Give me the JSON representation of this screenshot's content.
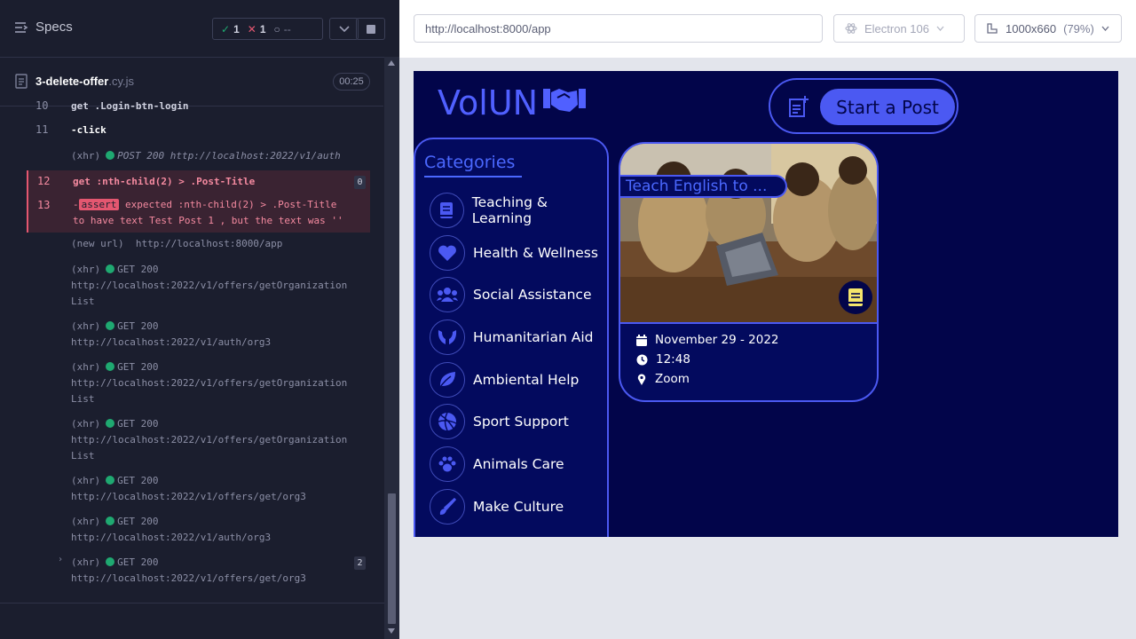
{
  "runner": {
    "specs_label": "Specs",
    "passed": "1",
    "failed": "1",
    "pending": "--",
    "file": {
      "name": "3-delete-offer",
      "ext": ".cy.js",
      "time": "00:25"
    }
  },
  "log": {
    "partial": {
      "num": "10",
      "text": "get  .Login-btn-login"
    },
    "click": {
      "num": "11",
      "text": "-click"
    },
    "xhr_auth": {
      "label": "(xhr)",
      "text": "POST 200 http://localhost:2022/v1/auth"
    },
    "get_cmd": {
      "num": "12",
      "text": "get  :nth-child(2) > .Post-Title",
      "count": "0"
    },
    "assert_cmd": {
      "num": "13",
      "tag": "assert",
      "line1": " expected  :nth-child(2) > .Post-Title",
      "line2": "to have text  Test Post 1 , but the text was  ''"
    },
    "new_url": {
      "label": "(new url)",
      "text": "http://localhost:8000/app"
    },
    "requests": [
      {
        "label": "(xhr)",
        "method": "GET 200",
        "url": "http://localhost:2022/v1/offers/getOrganization",
        "url2": "List"
      },
      {
        "label": "(xhr)",
        "method": "GET 200",
        "url": "http://localhost:2022/v1/auth/org3",
        "url2": ""
      },
      {
        "label": "(xhr)",
        "method": "GET 200",
        "url": "http://localhost:2022/v1/offers/getOrganization",
        "url2": "List"
      },
      {
        "label": "(xhr)",
        "method": "GET 200",
        "url": "http://localhost:2022/v1/offers/getOrganization",
        "url2": "List"
      },
      {
        "label": "(xhr)",
        "method": "GET 200",
        "url": "http://localhost:2022/v1/offers/get/org3",
        "url2": ""
      },
      {
        "label": "(xhr)",
        "method": "GET 200",
        "url": "http://localhost:2022/v1/auth/org3",
        "url2": ""
      },
      {
        "label": "(xhr)",
        "method": "GET 200",
        "url": "http://localhost:2022/v1/offers/get/org3",
        "url2": "",
        "count": "2"
      }
    ]
  },
  "browser_bar": {
    "url": "http://localhost:8000/app",
    "browser": "Electron 106",
    "viewport": "1000x660",
    "scale": "(79%)"
  },
  "app": {
    "logo_text": "VolUN",
    "start_post_label": "Start a Post",
    "categories_title": "Categories",
    "categories": [
      {
        "label": "Teaching & Learning",
        "icon": "book-icon"
      },
      {
        "label": "Health & Wellness",
        "icon": "heart-icon"
      },
      {
        "label": "Social Assistance",
        "icon": "people-icon"
      },
      {
        "label": "Humanitarian Aid",
        "icon": "hands-icon"
      },
      {
        "label": "Ambiental Help",
        "icon": "leaf-icon"
      },
      {
        "label": "Sport Support",
        "icon": "volleyball-icon"
      },
      {
        "label": "Animals Care",
        "icon": "paw-icon"
      },
      {
        "label": "Make Culture",
        "icon": "brush-icon"
      }
    ],
    "post": {
      "title": "Teach English to ...",
      "date": "November 29 - 2022",
      "time": "12:48",
      "location": "Zoom"
    }
  },
  "colors": {
    "accent": "#4b59f2",
    "app_bg": "#02054a",
    "runner_bg": "#1b1e2e",
    "error": "#e45770",
    "success": "#1fa971"
  }
}
